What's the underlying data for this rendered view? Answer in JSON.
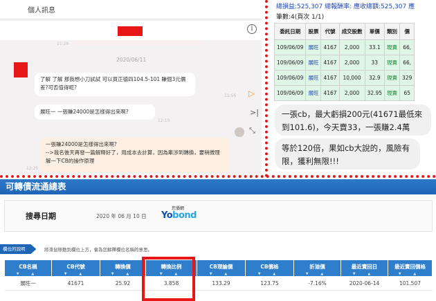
{
  "chat": {
    "top_label": "個人訊息",
    "time_faint": "11:26",
    "date_separator": "2020/06/11",
    "message_1": "了解 了解 那我想小刀試試 可以買正德四104.5-101 賺個3元價差?可否值得呢?",
    "message_1_time": "11:56",
    "message_2": "展旺一 一張賺24000是怎樣得出來啊?",
    "message_2_time": "12:10",
    "message_3_line1": "一張賺24000是怎樣得出來啊?",
    "message_3_line2": "-->我名後天再發一篇解釋好了，用成本去計算，因為牽涉到轉換，要稍微理解一下CB的操作原理",
    "message_3_time": "12:25",
    "info_glyph": "i",
    "side_icons": [
      "play-icon",
      "last-page-icon",
      "expand-icon"
    ]
  },
  "stock": {
    "summary": "總損益:525,307 總報酬率: 應收總額:525,307 應",
    "count": "筆數:4(頁次 1/1)",
    "columns": [
      "委託日期",
      "股票",
      "代號",
      "成交股數",
      "單價",
      "類別",
      "價"
    ],
    "rows": [
      [
        "109/06/09",
        "展旺",
        "4167",
        "2,000",
        "33.1",
        "現賣",
        "66,"
      ],
      [
        "109/06/09",
        "展旺",
        "4167",
        "2,000",
        "33",
        "現賣",
        "66,"
      ],
      [
        "109/06/09",
        "展旺",
        "4167",
        "10,000",
        "32.9",
        "現賣",
        "329"
      ],
      [
        "109/06/09",
        "展旺",
        "4167",
        "2,000",
        "32.95",
        "現賣",
        "65"
      ]
    ],
    "note_1": "一張cb，最大虧損200元(41671最低來到101.6)，今天賣33，一張賺2.4萬",
    "note_2": "等於120倍，果如cb大說的，風險有限，獲利無限!!!"
  },
  "cb": {
    "title": "可轉債流通總表",
    "search_label": "搜尋日期",
    "search_date": "2020 年 06 月 10 日",
    "logo_top": "您債網",
    "logo_main_1": "Yo",
    "logo_main_2": "bond",
    "hint_tag": "欄位的說明",
    "hint_text": "將滑鼠移動到欄位上方，會為您解釋欄位名稱的意思。",
    "columns": [
      "CB名稱",
      "CB代號",
      "轉換價",
      "轉換比例",
      "CB理論價",
      "CB價格",
      "折溢價",
      "最近賣回日",
      "最近賣回價格"
    ],
    "row": [
      "展旺一",
      "41671",
      "25.92",
      "3.858",
      "133.29",
      "123.75",
      "-7.16%",
      "2020-06-14",
      "101.507"
    ],
    "sort_arrows": "▼ ▲"
  }
}
